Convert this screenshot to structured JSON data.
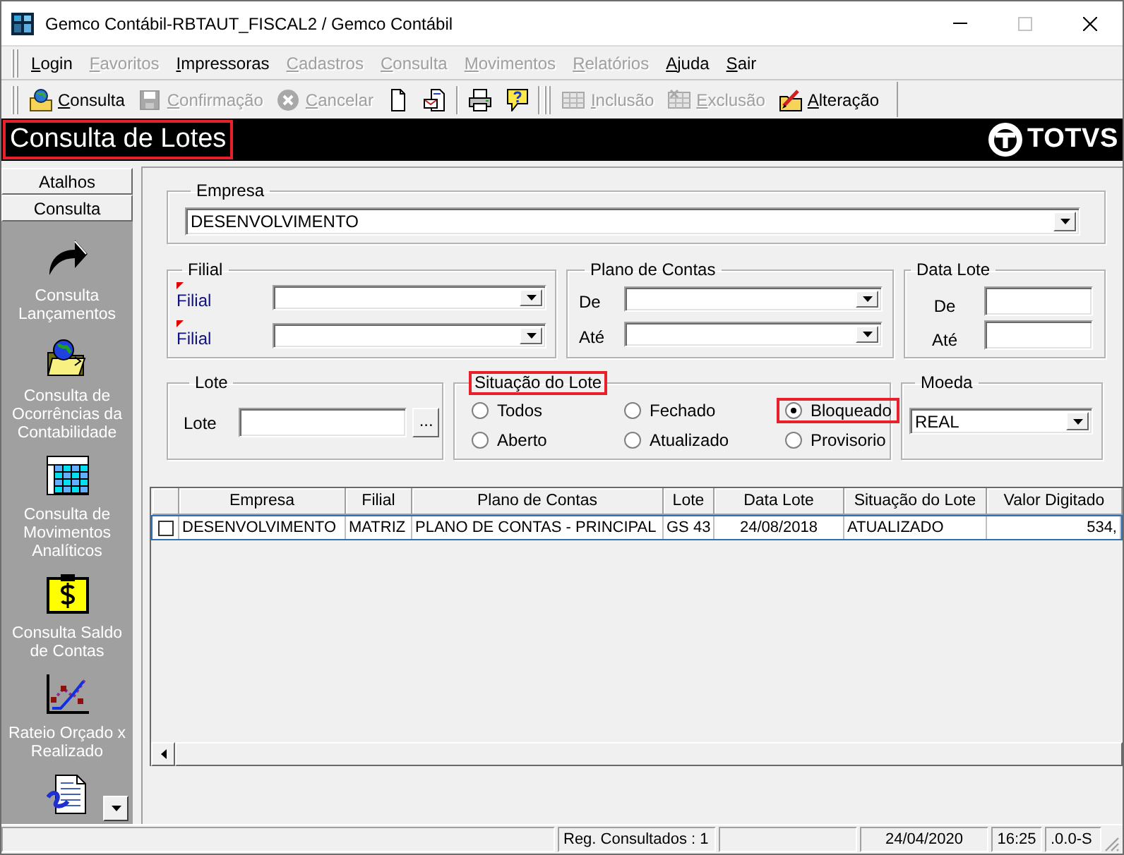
{
  "window": {
    "title": "Gemco Contábil-RBTAUT_FISCAL2 / Gemco Contábil",
    "buttons": [
      {
        "kind": "minimize",
        "disabled": false
      },
      {
        "kind": "maximize",
        "disabled": true
      },
      {
        "kind": "close",
        "disabled": false
      }
    ]
  },
  "menu": [
    {
      "label": "Login",
      "disabled": false
    },
    {
      "label": "Favoritos",
      "disabled": true
    },
    {
      "label": "Impressoras",
      "disabled": false
    },
    {
      "label": "Cadastros",
      "disabled": true
    },
    {
      "label": "Consulta",
      "disabled": true
    },
    {
      "label": "Movimentos",
      "disabled": true
    },
    {
      "label": "Relatórios",
      "disabled": true
    },
    {
      "label": "Ajuda",
      "disabled": false
    },
    {
      "label": "Sair",
      "disabled": false
    }
  ],
  "toolbar": [
    {
      "kind": "query",
      "label": "Consulta",
      "disabled": false
    },
    {
      "kind": "save",
      "label": "Confirmação",
      "disabled": true
    },
    {
      "kind": "cancel",
      "label": "Cancelar",
      "disabled": true
    },
    {
      "kind": "new",
      "disabled": false
    },
    {
      "kind": "attach",
      "disabled": false
    },
    {
      "kind": "separator"
    },
    {
      "kind": "print",
      "disabled": false
    },
    {
      "kind": "help",
      "disabled": false
    },
    {
      "kind": "band-break"
    },
    {
      "kind": "insert",
      "label": "Inclusão",
      "disabled": true
    },
    {
      "kind": "delete",
      "label": "Exclusão",
      "disabled": true
    },
    {
      "kind": "edit",
      "label": "Alteração",
      "disabled": false
    }
  ],
  "header": {
    "title": "Consulta de Lotes",
    "highlighted": true,
    "logo_text": "TOTVS"
  },
  "sidebar": {
    "sections": [
      "Atalhos",
      "Consulta"
    ],
    "items": [
      {
        "kind": "arrow",
        "label": "Consulta Lançamentos"
      },
      {
        "kind": "folder-globe",
        "label": "Consulta de Ocorrências da Contabilidade"
      },
      {
        "kind": "grid",
        "label": "Consulta de Movimentos Analíticos"
      },
      {
        "kind": "dollar",
        "label": "Consulta Saldo de Contas"
      },
      {
        "kind": "chart",
        "label": "Rateio Orçado x Realizado"
      },
      {
        "kind": "document"
      }
    ]
  },
  "empresa": {
    "label": "Empresa",
    "value": "DESENVOLVIMENTO"
  },
  "filial": {
    "label": "Filial",
    "fields": [
      {
        "label": "Filial",
        "required": true
      },
      {
        "label": "Filial",
        "required": true
      }
    ]
  },
  "plano_de_contas": {
    "label": "Plano de Contas",
    "fields": [
      {
        "label": "De"
      },
      {
        "label": "Até"
      }
    ]
  },
  "data_lote": {
    "label": "Data Lote",
    "fields": [
      {
        "label": "De"
      },
      {
        "label": "Até"
      }
    ]
  },
  "lote": {
    "label": "Lote",
    "field_label": "Lote",
    "button": "..."
  },
  "situacao_do_lote": {
    "label": "Situação do Lote",
    "highlighted": true,
    "options": [
      {
        "label": "Todos",
        "selected": false,
        "highlighted": false
      },
      {
        "label": "Fechado",
        "selected": false,
        "highlighted": false
      },
      {
        "label": "Bloqueado",
        "selected": true,
        "highlighted": true
      },
      {
        "label": "Aberto",
        "selected": false,
        "highlighted": false
      },
      {
        "label": "Atualizado",
        "selected": false,
        "highlighted": false
      },
      {
        "label": "Provisorio",
        "selected": false,
        "highlighted": false
      }
    ]
  },
  "moeda": {
    "label": "Moeda",
    "value": "REAL"
  },
  "table": {
    "columns": [
      "Empresa",
      "Filial",
      "Plano de Contas",
      "Lote",
      "Data Lote",
      "Situação do Lote",
      "Valor Digitado"
    ],
    "rows": [
      {
        "checked": false,
        "selected": true,
        "cells": [
          "DESENVOLVIMENTO",
          "MATRIZ",
          "PLANO DE CONTAS - PRINCIPAL",
          "GS 43",
          "24/08/2018",
          "ATUALIZADO",
          "534,"
        ]
      }
    ]
  },
  "status_bar": [
    {
      "kind": "blank"
    },
    {
      "kind": "text",
      "text": "Reg. Consultados : 1"
    },
    {
      "kind": "blank"
    },
    {
      "kind": "text",
      "text": "24/04/2020"
    },
    {
      "kind": "text",
      "text": "16:25"
    },
    {
      "kind": "text",
      "text": ".0.0-S"
    }
  ]
}
